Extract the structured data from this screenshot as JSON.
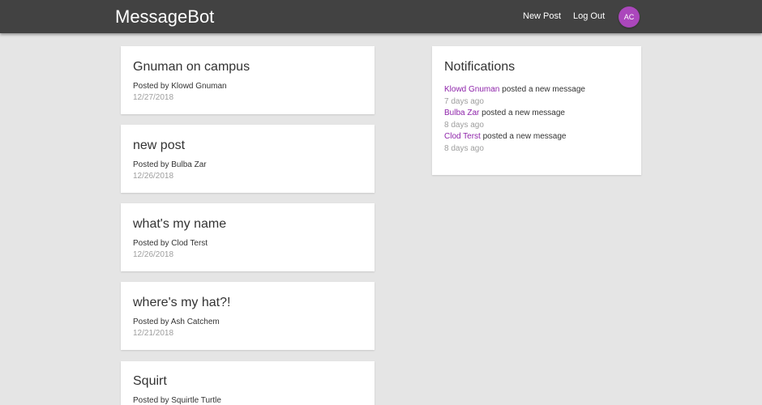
{
  "header": {
    "brand": "MessageBot",
    "new_post_label": "New Post",
    "logout_label": "Log Out",
    "avatar_initials": "AC"
  },
  "colors": {
    "header_bg": "#424242",
    "accent": "#ab47bc",
    "link": "#8e24aa",
    "page_bg": "#e5e5e5"
  },
  "posts": [
    {
      "title": "Gnuman on campus",
      "author": "Posted by Klowd Gnuman",
      "date": "12/27/2018"
    },
    {
      "title": "new post",
      "author": "Posted by Bulba Zar",
      "date": "12/26/2018"
    },
    {
      "title": "what's my name",
      "author": "Posted by Clod Terst",
      "date": "12/26/2018"
    },
    {
      "title": "where's my hat?!",
      "author": "Posted by Ash Catchem",
      "date": "12/21/2018"
    },
    {
      "title": "Squirt",
      "author": "Posted by Squirtle Turtle",
      "date": ""
    }
  ],
  "notifications": {
    "title": "Notifications",
    "items": [
      {
        "user": "Klowd Gnuman",
        "text": " posted a new message",
        "time": "7 days ago"
      },
      {
        "user": "Bulba Zar",
        "text": " posted a new message",
        "time": "8 days ago"
      },
      {
        "user": "Clod Terst",
        "text": " posted a new message",
        "time": "8 days ago"
      }
    ]
  }
}
